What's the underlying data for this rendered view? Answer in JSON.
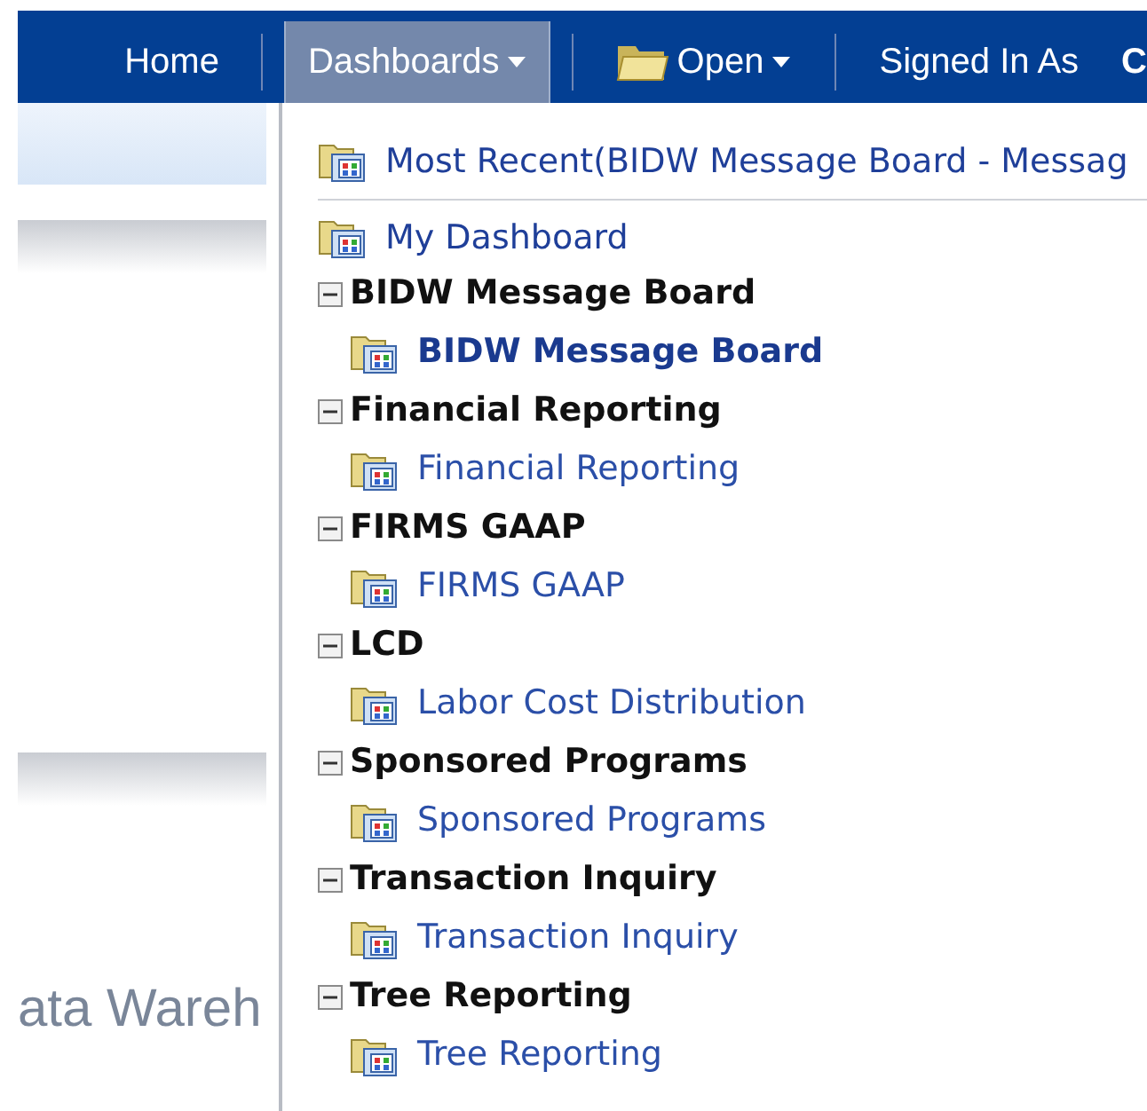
{
  "nav": [
    {
      "label": "Home",
      "selected": false,
      "kind": "link"
    },
    {
      "label": "Dashboards",
      "selected": true,
      "kind": "menu"
    },
    {
      "label": "Open",
      "selected": false,
      "kind": "folder-menu"
    },
    {
      "label": "Signed In As",
      "kind": "text"
    },
    {
      "label": "C",
      "kind": "text"
    }
  ],
  "page_heading": "ata Wareh",
  "menu": {
    "most_recent": "Most Recent(BIDW Message Board - Messag",
    "my_dashboard": "My Dashboard",
    "groups": [
      {
        "title": "BIDW Message Board",
        "expanded": true,
        "children": [
          {
            "label": "BIDW Message Board",
            "selected": true
          }
        ]
      },
      {
        "title": "Financial Reporting",
        "expanded": true,
        "children": [
          {
            "label": "Financial Reporting",
            "selected": false
          }
        ]
      },
      {
        "title": "FIRMS GAAP",
        "expanded": true,
        "children": [
          {
            "label": "FIRMS GAAP",
            "selected": false
          }
        ]
      },
      {
        "title": "LCD",
        "expanded": true,
        "children": [
          {
            "label": "Labor Cost Distribution",
            "selected": false
          }
        ]
      },
      {
        "title": "Sponsored Programs",
        "expanded": true,
        "children": [
          {
            "label": "Sponsored Programs",
            "selected": false
          }
        ]
      },
      {
        "title": "Transaction Inquiry",
        "expanded": true,
        "children": [
          {
            "label": "Transaction Inquiry",
            "selected": false
          }
        ]
      },
      {
        "title": "Tree Reporting",
        "expanded": true,
        "children": [
          {
            "label": "Tree Reporting",
            "selected": false
          }
        ]
      }
    ]
  }
}
